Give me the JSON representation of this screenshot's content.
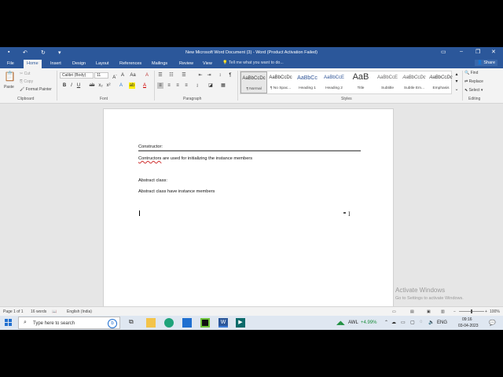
{
  "titlebar": {
    "title": "New Microsoft Word Document (3) - Word (Product Activation Failed)",
    "save_icon": "save-icon",
    "undo_icon": "undo-icon",
    "redo_icon": "redo-icon",
    "customize_icon": "customize-qat-icon"
  },
  "tabs": [
    "File",
    "Home",
    "Insert",
    "Design",
    "Layout",
    "References",
    "Mailings",
    "Review",
    "View"
  ],
  "active_tab": "Home",
  "tell_me": "Tell me what you want to do...",
  "share": "Share",
  "clipboard": {
    "paste": "Paste",
    "cut": "Cut",
    "copy": "Copy",
    "format_painter": "Format Painter",
    "label": "Clipboard"
  },
  "font": {
    "family": "Calibri (Body)",
    "size": "11",
    "label": "Font"
  },
  "paragraph": {
    "label": "Paragraph"
  },
  "styles": {
    "label": "Styles",
    "items": [
      {
        "preview": "AaBbCcDc",
        "label": "¶ Normal"
      },
      {
        "preview": "AaBbCcDc",
        "label": "¶ No Spac..."
      },
      {
        "preview": "AaBbCc",
        "label": "Heading 1"
      },
      {
        "preview": "AaBbCcE",
        "label": "Heading 2"
      },
      {
        "preview": "AaB",
        "label": "Title"
      },
      {
        "preview": "AaBbCcE",
        "label": "Subtitle"
      },
      {
        "preview": "AaBbCcDc",
        "label": "Subtle Em..."
      },
      {
        "preview": "AaBbCcDc",
        "label": "Emphasis"
      }
    ]
  },
  "editing": {
    "find": "Find",
    "replace": "Replace",
    "select": "Select",
    "label": "Editing"
  },
  "document": {
    "lines": [
      "Constructor:",
      "Contructors",
      " are used for initializing the instance members",
      "Abstract class:",
      "Abstract class have instance members"
    ]
  },
  "watermark": {
    "title": "Activate Windows",
    "subtitle": "Go to Settings to activate Windows."
  },
  "statusbar": {
    "page": "Page 1 of 1",
    "words": "16 words",
    "language": "English (India)",
    "zoom": "100%"
  },
  "taskbar": {
    "search_placeholder": "Type here to search",
    "stock_name": "AWL",
    "stock_change": "+4.99%",
    "lang": "ENG",
    "time": "09:16",
    "date": "03-04-2023"
  }
}
